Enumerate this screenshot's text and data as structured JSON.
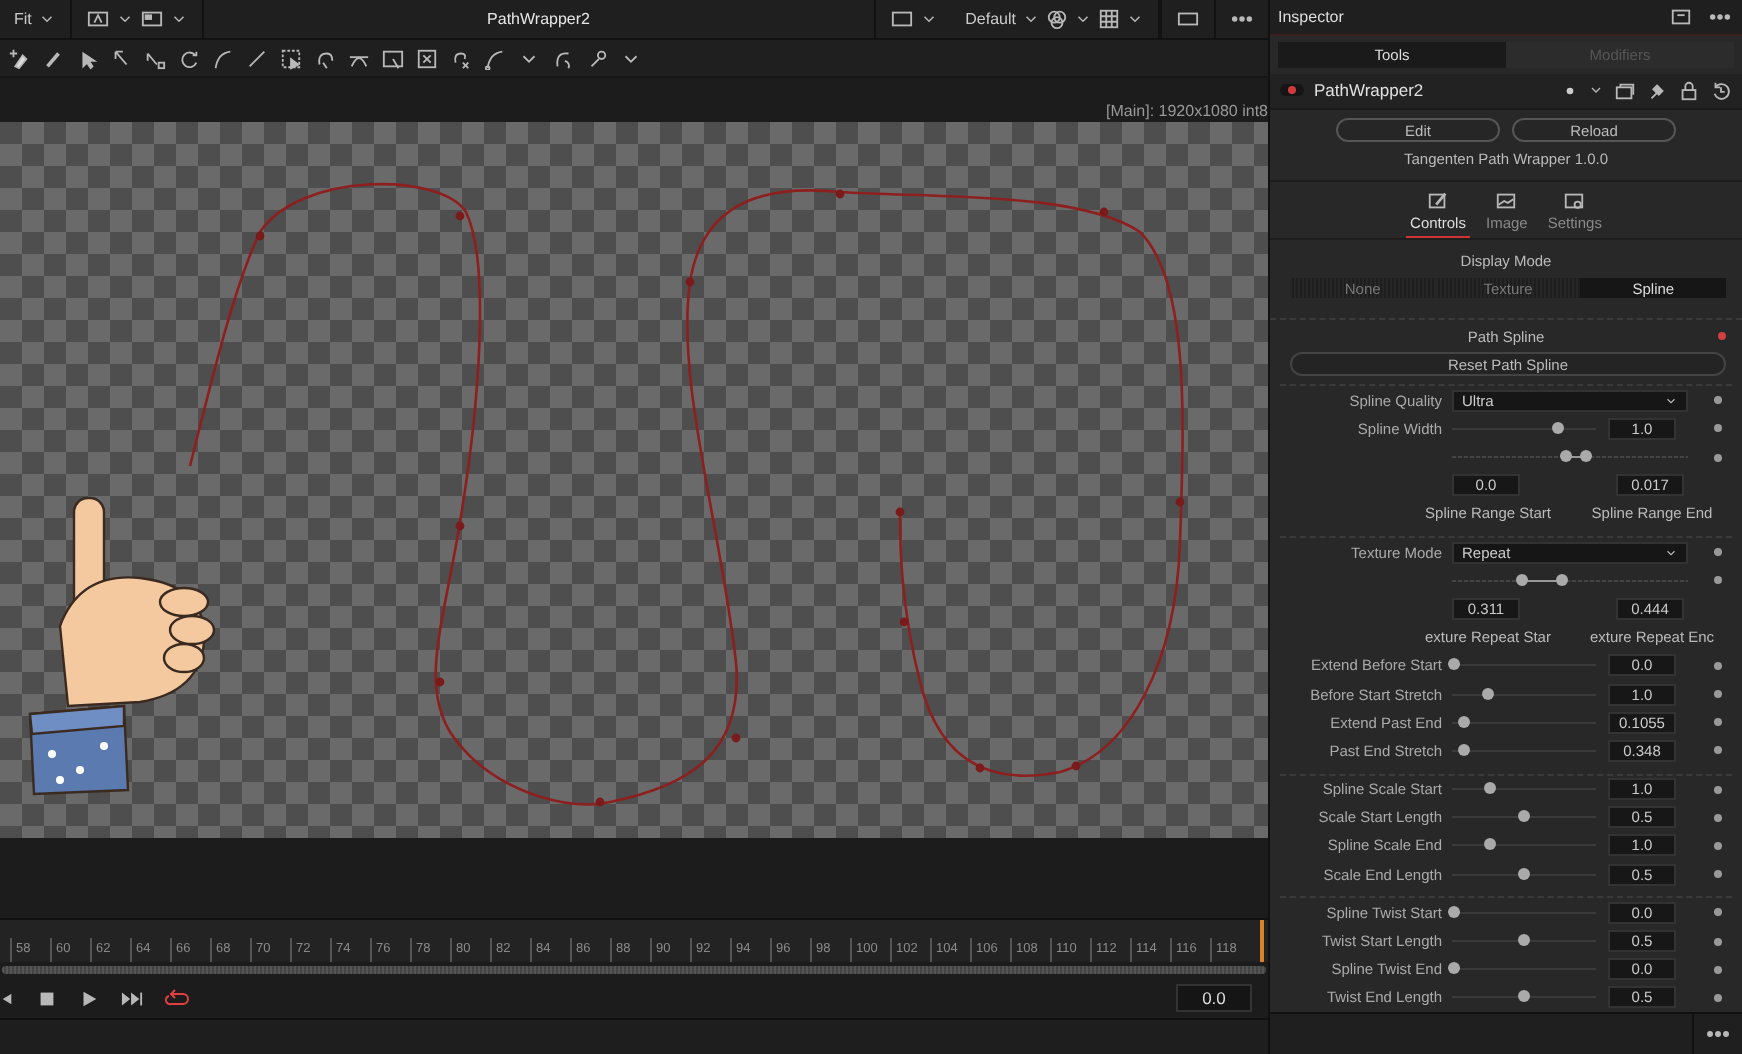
{
  "viewer": {
    "fit": "Fit",
    "title": "PathWrapper2",
    "layout": "Default",
    "info": "[Main]: 1920x1080 int8"
  },
  "timeline": {
    "ticks": [
      "58",
      "60",
      "62",
      "64",
      "66",
      "68",
      "70",
      "72",
      "74",
      "76",
      "78",
      "80",
      "82",
      "84",
      "86",
      "88",
      "90",
      "92",
      "94",
      "96",
      "98",
      "100",
      "102",
      "104",
      "106",
      "108",
      "110",
      "112",
      "114",
      "116",
      "118"
    ],
    "time": "0.0"
  },
  "inspector": {
    "title": "Inspector",
    "tabs": [
      {
        "label": "Tools",
        "selected": true
      },
      {
        "label": "Modifiers",
        "selected": false
      }
    ],
    "node": {
      "name": "PathWrapper2",
      "enabled": true
    },
    "buttons": [
      "Edit",
      "Reload"
    ],
    "version": "Tangenten Path Wrapper 1.0.0",
    "panel_tabs": [
      {
        "label": "Controls",
        "selected": true
      },
      {
        "label": "Image",
        "selected": false
      },
      {
        "label": "Settings",
        "selected": false
      }
    ],
    "display_mode": {
      "label": "Display Mode",
      "options": [
        {
          "label": "None",
          "selected": false
        },
        {
          "label": "Texture",
          "selected": false
        },
        {
          "label": "Spline",
          "selected": true
        }
      ]
    },
    "path_spline": {
      "label": "Path Spline",
      "button": "Reset Path Spline"
    },
    "groups": [
      {
        "params": [
          {
            "kind": "dropdown",
            "label": "Spline Quality",
            "value": "Ultra"
          },
          {
            "kind": "slider",
            "label": "Spline Width",
            "level": 0.73,
            "value": "1.0"
          },
          {
            "kind": "range",
            "start": {
              "level": 0.48,
              "value": "0.0",
              "label": "Spline Range Start"
            },
            "end": {
              "level": 0.57,
              "value": "0.017",
              "label": "Spline Range End"
            }
          }
        ]
      },
      {
        "params": [
          {
            "kind": "dropdown",
            "label": "Texture Mode",
            "value": "Repeat"
          },
          {
            "kind": "range",
            "start": {
              "level": 0.3,
              "value": "0.311",
              "label": "exture Repeat Star"
            },
            "end": {
              "level": 0.47,
              "value": "0.444",
              "label": "exture Repeat Enc"
            }
          },
          {
            "kind": "slider",
            "label": "Extend Before Start",
            "level": 0.02,
            "value": "0.0"
          },
          {
            "kind": "slider",
            "label": "Before Start Stretch",
            "level": 0.25,
            "value": "1.0"
          },
          {
            "kind": "slider",
            "label": "Extend Past End",
            "level": 0.08,
            "value": "0.1055"
          },
          {
            "kind": "slider",
            "label": "Past End Stretch",
            "level": 0.08,
            "value": "0.348"
          }
        ]
      },
      {
        "params": [
          {
            "kind": "slider",
            "label": "Spline Scale Start",
            "level": 0.27,
            "value": "1.0"
          },
          {
            "kind": "slider",
            "label": "Scale Start Length",
            "level": 0.5,
            "value": "0.5"
          },
          {
            "kind": "slider",
            "label": "Spline Scale End",
            "level": 0.27,
            "value": "1.0"
          },
          {
            "kind": "slider",
            "label": "Scale End Length",
            "level": 0.5,
            "value": "0.5"
          }
        ]
      },
      {
        "params": [
          {
            "kind": "slider",
            "label": "Spline Twist Start",
            "level": 0.02,
            "value": "0.0"
          },
          {
            "kind": "slider",
            "label": "Twist Start Length",
            "level": 0.5,
            "value": "0.5"
          },
          {
            "kind": "slider",
            "label": "Spline Twist End",
            "level": 0.02,
            "value": "0.0"
          },
          {
            "kind": "slider",
            "label": "Twist End Length",
            "level": 0.5,
            "value": "0.5"
          }
        ]
      }
    ]
  }
}
